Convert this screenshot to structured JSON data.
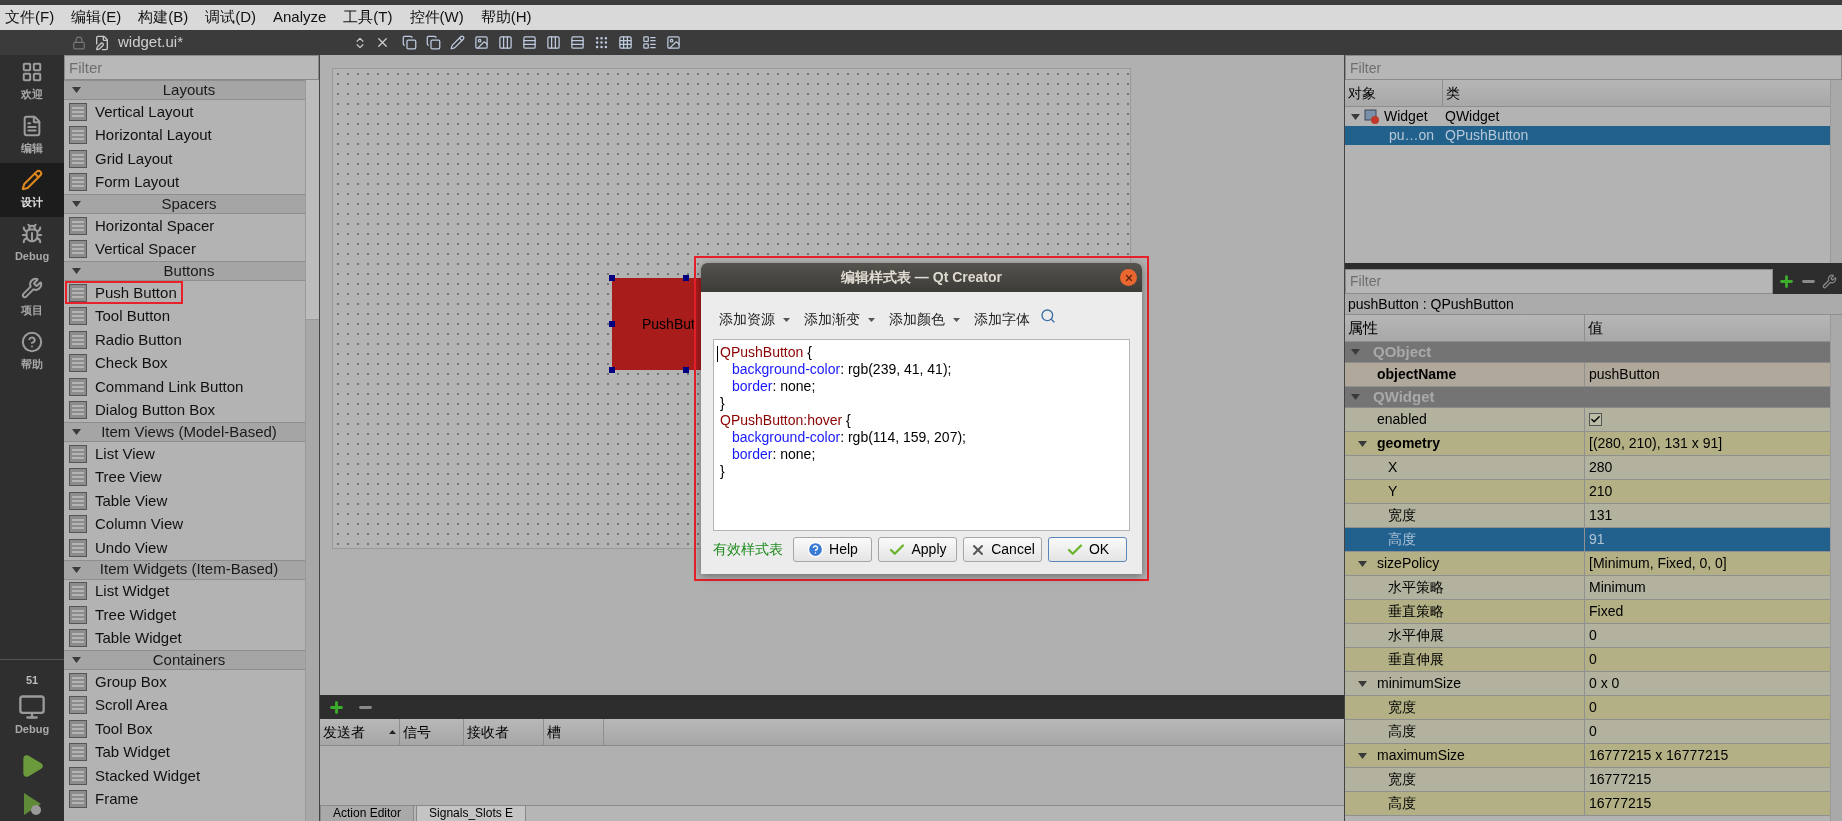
{
  "menu": [
    "文件(F)",
    "编辑(E)",
    "构建(B)",
    "调试(D)",
    "Analyze",
    "工具(T)",
    "控件(W)",
    "帮助(H)"
  ],
  "editor_tab": {
    "title": "widget.ui*"
  },
  "mode_bar": {
    "items": [
      {
        "label": "欢迎",
        "kind": "welcome",
        "selected": false
      },
      {
        "label": "编辑",
        "kind": "edit",
        "selected": false
      },
      {
        "label": "设计",
        "kind": "design",
        "selected": true
      },
      {
        "label": "Debug",
        "kind": "debug",
        "selected": false
      },
      {
        "label": "项目",
        "kind": "projects",
        "selected": false
      },
      {
        "label": "帮助",
        "kind": "help",
        "selected": false
      }
    ],
    "kit": {
      "count": "51",
      "label": "Debug"
    }
  },
  "widget_box": {
    "filter": {
      "placeholder": "Filter"
    },
    "groups": [
      {
        "title": "Layouts",
        "expanded": true,
        "items": [
          {
            "label": "Vertical Layout",
            "marked": false
          },
          {
            "label": "Horizontal Layout",
            "marked": false
          },
          {
            "label": "Grid Layout",
            "marked": false
          },
          {
            "label": "Form Layout",
            "marked": false
          }
        ]
      },
      {
        "title": "Spacers",
        "expanded": true,
        "items": [
          {
            "label": "Horizontal Spacer",
            "marked": false
          },
          {
            "label": "Vertical Spacer",
            "marked": false
          }
        ]
      },
      {
        "title": "Buttons",
        "expanded": true,
        "items": [
          {
            "label": "Push Button",
            "marked": true
          },
          {
            "label": "Tool Button",
            "marked": false
          },
          {
            "label": "Radio Button",
            "marked": false
          },
          {
            "label": "Check Box",
            "marked": false
          },
          {
            "label": "Command Link Button",
            "marked": false
          },
          {
            "label": "Dialog Button Box",
            "marked": false
          }
        ]
      },
      {
        "title": "Item Views (Model-Based)",
        "expanded": true,
        "items": [
          {
            "label": "List View",
            "marked": false
          },
          {
            "label": "Tree View",
            "marked": false
          },
          {
            "label": "Table View",
            "marked": false
          },
          {
            "label": "Column View",
            "marked": false
          },
          {
            "label": "Undo View",
            "marked": false
          }
        ]
      },
      {
        "title": "Item Widgets (Item-Based)",
        "expanded": true,
        "items": [
          {
            "label": "List Widget",
            "marked": false
          },
          {
            "label": "Tree Widget",
            "marked": false
          },
          {
            "label": "Table Widget",
            "marked": false
          }
        ]
      },
      {
        "title": "Containers",
        "expanded": true,
        "items": [
          {
            "label": "Group Box",
            "marked": false
          },
          {
            "label": "Scroll Area",
            "marked": false
          },
          {
            "label": "Tool Box",
            "marked": false
          },
          {
            "label": "Tab Widget",
            "marked": false
          },
          {
            "label": "Stacked Widget",
            "marked": false
          },
          {
            "label": "Frame",
            "marked": false
          }
        ]
      }
    ]
  },
  "form": {
    "push_button": {
      "label": "PushBut",
      "selected": true
    }
  },
  "style_dialog": {
    "title": "编辑样式表 — Qt Creator",
    "highlighted": true,
    "toolbar": [
      {
        "label": "添加资源",
        "dropdown": true
      },
      {
        "label": "添加渐变",
        "dropdown": true
      },
      {
        "label": "添加颜色",
        "dropdown": true
      },
      {
        "label": "添加字体",
        "dropdown": false
      }
    ],
    "code": [
      [
        {
          "kind": "selector",
          "text": "QPushButton"
        },
        {
          "kind": "plain",
          "text": " {"
        }
      ],
      [
        {
          "kind": "property",
          "text": "background-color"
        },
        {
          "kind": "plain",
          "text": ": rgb(239, 41, 41);"
        }
      ],
      [
        {
          "kind": "property",
          "text": "border"
        },
        {
          "kind": "plain",
          "text": ": none;"
        }
      ],
      [
        {
          "kind": "plain",
          "text": "}"
        }
      ],
      [
        {
          "kind": "selector",
          "text": "QPushButton:hover"
        },
        {
          "kind": "plain",
          "text": " {"
        }
      ],
      [
        {
          "kind": "property",
          "text": "background-color"
        },
        {
          "kind": "plain",
          "text": ": rgb(114, 159, 207);"
        }
      ],
      [
        {
          "kind": "property",
          "text": "border"
        },
        {
          "kind": "plain",
          "text": ": none;"
        }
      ],
      [
        {
          "kind": "plain",
          "text": "}"
        }
      ]
    ],
    "status": "有效样式表",
    "buttons": [
      {
        "label": "Help",
        "kind": "help",
        "default": false
      },
      {
        "label": "Apply",
        "kind": "apply",
        "default": false
      },
      {
        "label": "Cancel",
        "kind": "cancel",
        "default": false
      },
      {
        "label": "OK",
        "kind": "ok",
        "default": true
      }
    ]
  },
  "signals_slots": {
    "columns": [
      {
        "label": "发送者",
        "sorted": true
      },
      {
        "label": "信号",
        "sorted": false
      },
      {
        "label": "接收者",
        "sorted": false
      },
      {
        "label": "槽",
        "sorted": false
      }
    ],
    "tabs": [
      {
        "label": "Action Editor",
        "selected": false
      },
      {
        "label": "Signals_Slots E",
        "selected": true
      }
    ]
  },
  "object_inspector": {
    "filter": {
      "placeholder": "Filter"
    },
    "columns": [
      "对象",
      "类"
    ],
    "tree": [
      {
        "name": "Widget",
        "class": "QWidget",
        "expanded": true,
        "selected": false,
        "children": [
          {
            "name": "pu…on",
            "class": "QPushButton",
            "selected": true
          }
        ]
      }
    ]
  },
  "property_editor": {
    "filter": {
      "placeholder": "Filter"
    },
    "object_label": "pushButton : QPushButton",
    "columns": [
      "属性",
      "值"
    ],
    "groups": [
      {
        "name": "QObject",
        "expanded": true,
        "properties": [
          {
            "name": "objectName",
            "value": "pushButton",
            "modified": true,
            "selected": false
          }
        ]
      },
      {
        "name": "QWidget",
        "expanded": true,
        "properties": [
          {
            "name": "enabled",
            "kind": "checkbox",
            "checked": true,
            "modified": false,
            "selected": false
          },
          {
            "name": "geometry",
            "value": "[(280, 210), 131 x 91]",
            "modified": true,
            "selected": false,
            "expanded": true,
            "children": [
              {
                "name": "X",
                "value": "280",
                "modified": false,
                "selected": false
              },
              {
                "name": "Y",
                "value": "210",
                "modified": false,
                "selected": false
              },
              {
                "name": "宽度",
                "value": "131",
                "modified": false,
                "selected": false
              },
              {
                "name": "高度",
                "value": "91",
                "modified": false,
                "selected": true
              }
            ]
          },
          {
            "name": "sizePolicy",
            "value": "[Minimum, Fixed, 0, 0]",
            "modified": false,
            "selected": false,
            "expanded": true,
            "children": [
              {
                "name": "水平策略",
                "value": "Minimum",
                "modified": false,
                "selected": false
              },
              {
                "name": "垂直策略",
                "value": "Fixed",
                "modified": false,
                "selected": false
              },
              {
                "name": "水平伸展",
                "value": "0",
                "modified": false,
                "selected": false
              },
              {
                "name": "垂直伸展",
                "value": "0",
                "modified": false,
                "selected": false
              }
            ]
          },
          {
            "name": "minimumSize",
            "value": "0 x 0",
            "modified": false,
            "selected": false,
            "expanded": true,
            "children": [
              {
                "name": "宽度",
                "value": "0",
                "modified": false,
                "selected": false
              },
              {
                "name": "高度",
                "value": "0",
                "modified": false,
                "selected": false
              }
            ]
          },
          {
            "name": "maximumSize",
            "value": "16777215 x 16777215",
            "modified": false,
            "selected": false,
            "expanded": true,
            "children": [
              {
                "name": "宽度",
                "value": "16777215",
                "modified": false,
                "selected": false
              },
              {
                "name": "高度",
                "value": "16777215",
                "modified": false,
                "selected": false
              }
            ]
          }
        ]
      }
    ]
  }
}
